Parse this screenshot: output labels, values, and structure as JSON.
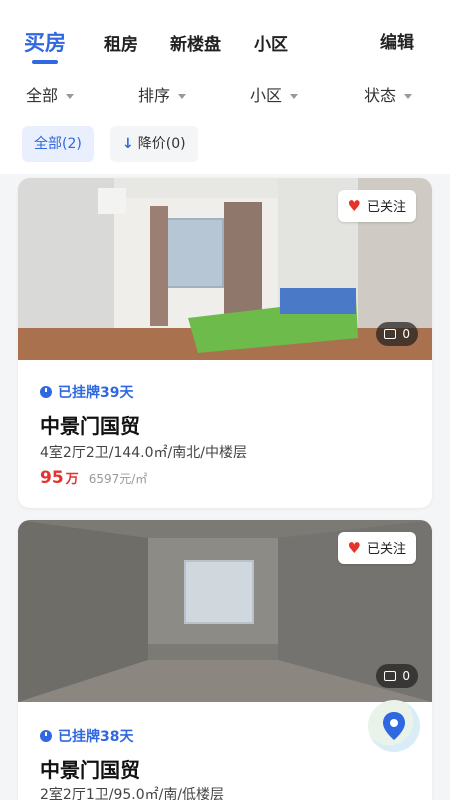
{
  "tabs": [
    "买房",
    "租房",
    "新楼盘",
    "小区"
  ],
  "edit_label": "编辑",
  "filters": [
    "全部",
    "排序",
    "小区",
    "状态"
  ],
  "chips": {
    "all": "全部(2)",
    "price_drop": "降价(0)"
  },
  "listings": [
    {
      "follow_label": "已关注",
      "image_count": "0",
      "listed": "已挂牌39天",
      "name": "中景门国贸",
      "specs": "4室2厅2卫/144.0㎡/南北/中楼层",
      "price": "95",
      "price_unit": "万",
      "unit_price": "6597元/㎡"
    },
    {
      "follow_label": "已关注",
      "image_count": "0",
      "listed": "已挂牌38天",
      "name": "中景门国贸",
      "specs": "2室2厅1卫/95.0㎡/南/低楼层"
    }
  ],
  "colors": {
    "accent": "#2f68e0",
    "price": "#e0322f",
    "heart": "#e6332a"
  },
  "icons": [
    "heart-icon",
    "image-icon",
    "clock-icon",
    "down-arrow-icon",
    "map-pin-icon",
    "caret-down-icon"
  ]
}
